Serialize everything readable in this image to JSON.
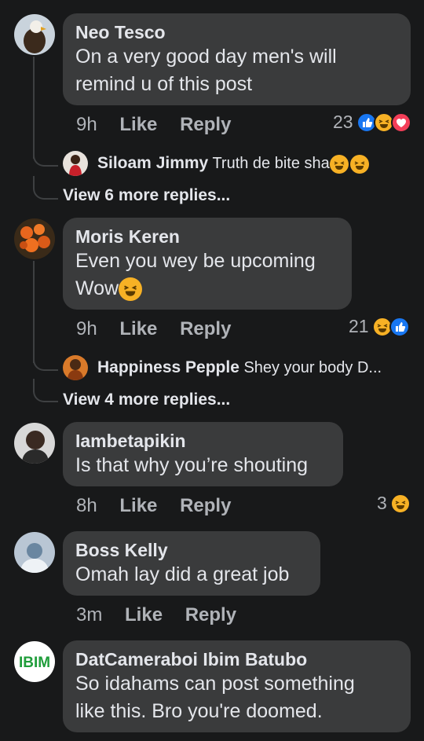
{
  "comments": [
    {
      "author": "Neo Tesco",
      "text_lines": [
        "On a very good day men's will",
        "remind u of this post"
      ],
      "time": "9h",
      "like_label": "Like",
      "reply_label": "Reply",
      "reaction_count": "23",
      "reactions": [
        "like-icon",
        "laugh-icon",
        "love-icon"
      ],
      "reply_preview": {
        "author": "Siloam Jimmy",
        "text": "Truth de bite sha"
      },
      "more_replies": "View 6 more replies...",
      "avatar_icon": "eagle-avatar"
    },
    {
      "author": "Moris Keren",
      "text_lines": [
        "Even you wey be upcoming",
        "Wow"
      ],
      "time": "9h",
      "like_label": "Like",
      "reply_label": "Reply",
      "reaction_count": "21",
      "reactions": [
        "laugh-icon",
        "like-icon"
      ],
      "reply_preview": {
        "author": "Happiness Pepple",
        "text": "Shey your body D..."
      },
      "more_replies": "View 4 more replies...",
      "avatar_icon": "flowers-avatar"
    },
    {
      "author": "Iambetapikin",
      "text_lines": [
        "Is that why you’re shouting"
      ],
      "time": "8h",
      "like_label": "Like",
      "reply_label": "Reply",
      "reaction_count": "3",
      "reactions": [
        "laugh-icon"
      ],
      "avatar_icon": "person-avatar"
    },
    {
      "author": "Boss Kelly",
      "text_lines": [
        "Omah lay did a great job"
      ],
      "time": "3m",
      "like_label": "Like",
      "reply_label": "Reply",
      "avatar_icon": "person-avatar"
    },
    {
      "author": "DatCameraboi Ibim Batubo",
      "text_lines": [
        "So idahams can post something",
        "like this. Bro you're doomed."
      ],
      "avatar_icon": "ibim-logo-avatar",
      "avatar_logo_text": "IBIM"
    }
  ],
  "colors": {
    "background": "#18191a",
    "bubble": "#3a3b3c",
    "text": "#e4e6eb",
    "muted": "#b0b3b8",
    "like_blue": "#1877f2",
    "laugh_yellow": "#f7b125",
    "love_red": "#f33e58"
  }
}
